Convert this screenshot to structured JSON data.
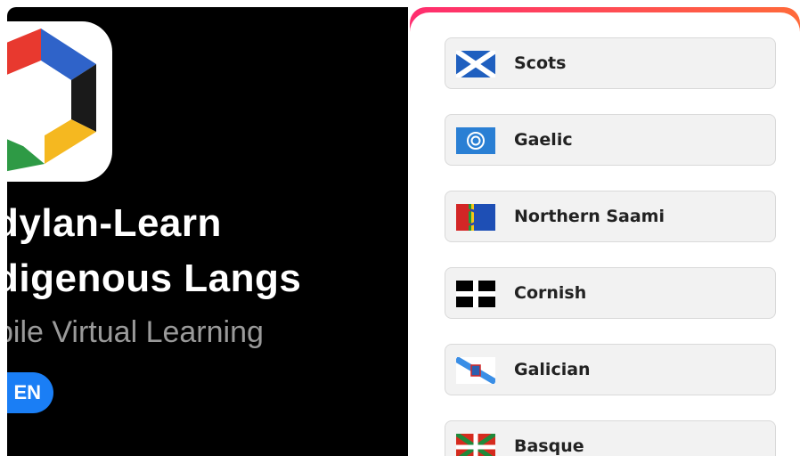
{
  "app": {
    "title_line1": "dylan-Learn",
    "title_line2": "digenous Langs",
    "subtitle": "bile Virtual Learning",
    "open_button": "EN",
    "icon_colors": [
      "#e8392f",
      "#2f63c9",
      "#f5b820",
      "#2e9a45"
    ]
  },
  "languages": [
    {
      "label": "Scots",
      "flag_icon": "scotland-flag-icon"
    },
    {
      "label": "Gaelic",
      "flag_icon": "gaelic-flag-icon"
    },
    {
      "label": "Northern Saami",
      "flag_icon": "saami-flag-icon"
    },
    {
      "label": "Cornish",
      "flag_icon": "cornish-flag-icon"
    },
    {
      "label": "Galician",
      "flag_icon": "galician-flag-icon"
    },
    {
      "label": "Basque",
      "flag_icon": "basque-flag-icon"
    }
  ],
  "colors": {
    "accent_blue": "#1a7ef5",
    "header_gradient": [
      "#ff2d6f",
      "#ff6a3a"
    ]
  }
}
